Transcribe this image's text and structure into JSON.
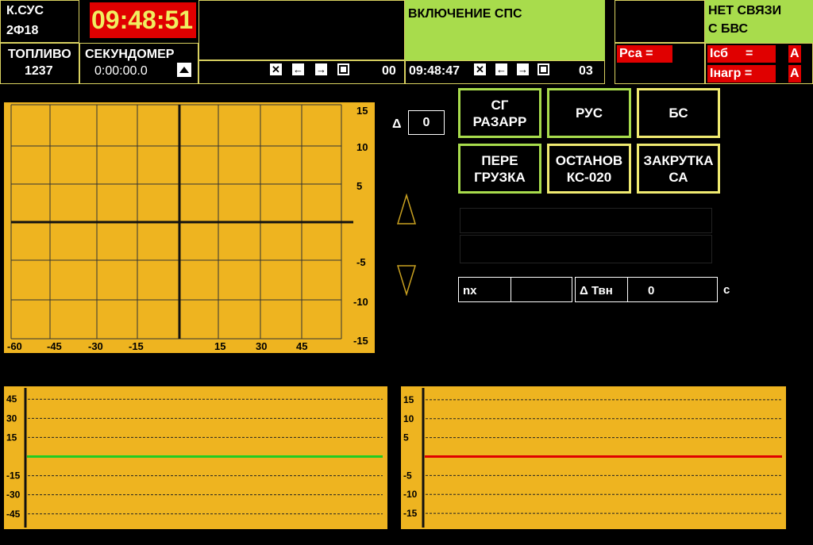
{
  "header": {
    "k_sus_label": "К.СУС",
    "k_sus_value": "2Ф18",
    "clock": "09:48:51",
    "fuel_label": "ТОПЛИВО",
    "fuel_value": "1237",
    "stopwatch_label": "СЕКУНДОМЕР",
    "stopwatch_value": "0:00:00.0",
    "left_counter": "00",
    "message": "ВКЛЮЧЕНИЕ СПС",
    "message_time": "09:48:47",
    "right_counter": "03",
    "connection_status_line1": "НЕТ СВЯЗИ",
    "connection_status_line2": "С БВС",
    "rsa_label": "Рса  =",
    "icb_label": "Iсб",
    "icb_eq": "=",
    "icb_unit": "А",
    "inagr_label": "Iнагр =",
    "inagr_unit": "А"
  },
  "delta": {
    "symbol": "Δ",
    "value": "0"
  },
  "buttons": {
    "sg_razarr": "СГ\nРАЗАРР",
    "rus": "РУС",
    "bs": "БС",
    "peregruzka": "ПЕРЕ\nГРУЗКА",
    "ostanov": "ОСТАНОВ\nКС-020",
    "zakrutka": "ЗАКРУТКА\nСА"
  },
  "readout": {
    "nx_label": "nx",
    "nx_value": "",
    "dtvn_label": "Δ Твн",
    "dtvn_value": "0",
    "dtvn_unit": "с"
  },
  "main_chart": {
    "x_ticks_left": [
      "-60",
      "-45",
      "-30",
      "-15"
    ],
    "x_ticks_right": [
      "15",
      "30",
      "45"
    ],
    "y_ticks": [
      "15",
      "10",
      "5",
      "-5",
      "-10",
      "-15"
    ]
  },
  "chart_data": [
    {
      "type": "line",
      "title": "",
      "xlabel": "",
      "ylabel": "",
      "x_ticks": [
        -60,
        -45,
        -30,
        -15,
        15,
        30,
        45
      ],
      "y_ticks": [
        15,
        10,
        5,
        -5,
        -10,
        -15
      ],
      "ylim": [
        -15,
        15
      ],
      "series": [],
      "grid": true,
      "background": "#eeb420"
    },
    {
      "type": "line",
      "title": "",
      "y_ticks": [
        45,
        30,
        15,
        -15,
        -30,
        -45
      ],
      "ylim": [
        -52,
        52
      ],
      "series": [
        {
          "color": "#22cc22",
          "values": [
            0,
            0
          ]
        }
      ],
      "grid": true,
      "background": "#eeb420"
    },
    {
      "type": "line",
      "title": "",
      "y_ticks": [
        15,
        10,
        5,
        -5,
        -10,
        -15
      ],
      "ylim": [
        -17.5,
        17.5
      ],
      "series": [
        {
          "color": "#e00000",
          "values": [
            0,
            0
          ]
        }
      ],
      "grid": true,
      "background": "#eeb420"
    }
  ],
  "colors": {
    "panel_bg": "#eeb420",
    "status_green": "#a8dc4c",
    "alarm_red": "#e00000",
    "frame_yellow": "#d8d060",
    "arrow_outline": "#c8a020"
  },
  "icons": {
    "close": "x-box-icon",
    "left": "arrow-left-icon",
    "right": "arrow-right-icon",
    "stop": "square-icon",
    "up": "triangle-up-icon"
  }
}
